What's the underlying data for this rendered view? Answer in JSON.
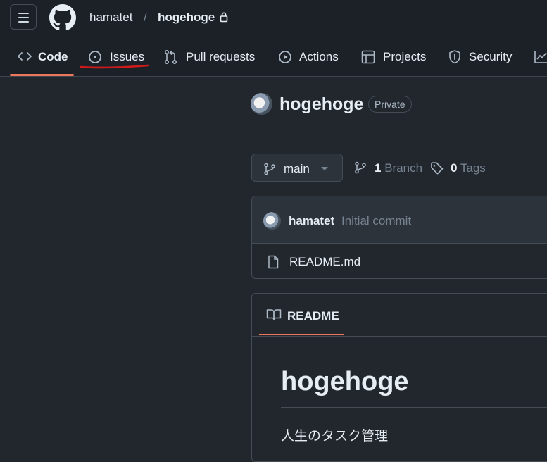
{
  "header": {
    "owner": "hamatet",
    "separator": "/",
    "repo": "hogehoge"
  },
  "tabs": [
    {
      "label": "Code",
      "icon": "code-icon",
      "active": true
    },
    {
      "label": "Issues",
      "icon": "issue-opened-icon"
    },
    {
      "label": "Pull requests",
      "icon": "git-pull-request-icon"
    },
    {
      "label": "Actions",
      "icon": "play-icon"
    },
    {
      "label": "Projects",
      "icon": "table-icon"
    },
    {
      "label": "Security",
      "icon": "shield-icon"
    }
  ],
  "repo": {
    "name": "hogehoge",
    "visibility": "Private"
  },
  "branch_bar": {
    "current_branch": "main",
    "branch_count": "1",
    "branch_label": "Branch",
    "tag_count": "0",
    "tag_label": "Tags"
  },
  "commit": {
    "author": "hamatet",
    "message": "Initial commit"
  },
  "files": [
    {
      "name": "README.md",
      "icon": "file-icon"
    }
  ],
  "readme": {
    "tab_label": "README",
    "heading": "hogehoge",
    "body": "人生のタスク管理"
  },
  "colors": {
    "accent_underline": "#ec775c",
    "annotation_red": "#d11a1a",
    "page_background": "#22272e",
    "header_background": "#1c2128"
  }
}
